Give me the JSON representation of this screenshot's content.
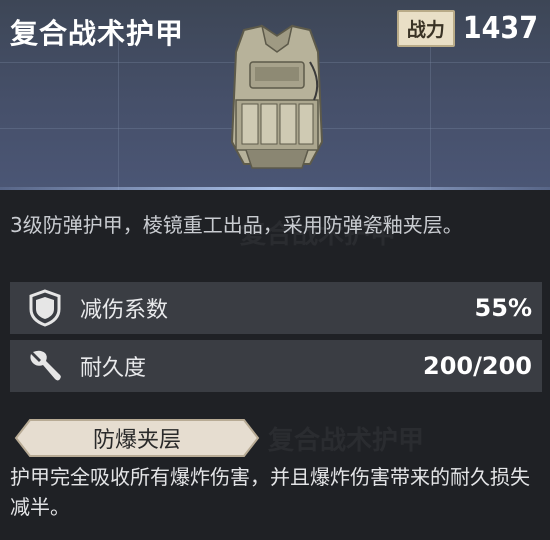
{
  "item": {
    "name": "复合战术护甲",
    "power_label": "战力",
    "power_value": "1437",
    "description": "3级防弹护甲，棱镜重工出品，采用防弹瓷釉夹层。"
  },
  "stats": [
    {
      "name": "减伤系数",
      "value": "55%",
      "icon": "shield-icon"
    },
    {
      "name": "耐久度",
      "value": "200/200",
      "icon": "wrench-icon"
    }
  ],
  "trait": {
    "name": "防爆夹层",
    "description": "护甲完全吸收所有爆炸伤害，并且爆炸伤害带来的耐久损失减半。"
  },
  "colors": {
    "header_bg": "#46506a",
    "power_badge": "#e9dfc6",
    "stat_row_bg": "#3a3d43",
    "trait_tag": "#e6ddd0"
  }
}
